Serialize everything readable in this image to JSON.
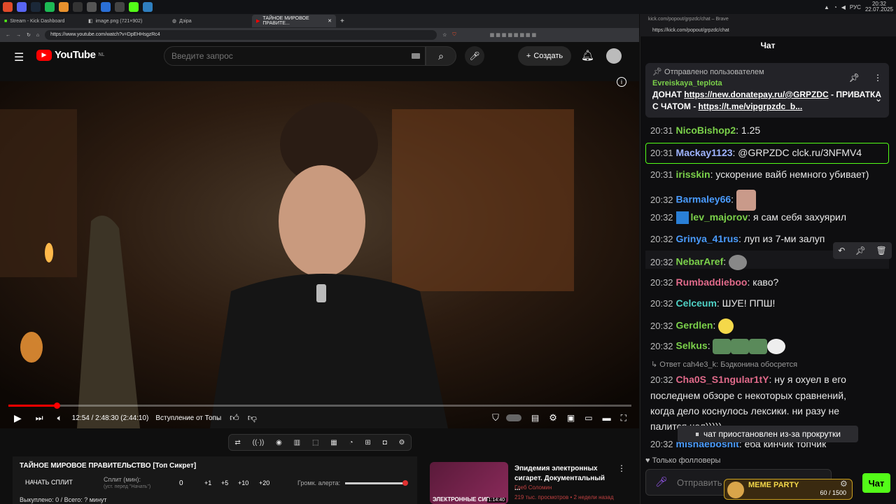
{
  "taskbar": {
    "clock_time": "20:32",
    "clock_date": "22.07.2025",
    "lang": "РУС"
  },
  "browser": {
    "tabs": [
      {
        "label": "Stream - Kick Dashboard"
      },
      {
        "label": "image.png (721×902)"
      },
      {
        "label": "Дзіра"
      },
      {
        "label": "ТАЙНОЕ МИРОВОЕ ПРАВИТЕ..."
      }
    ],
    "url": "https://www.youtube.com/watch?v=DpEHHsgzRc4"
  },
  "youtube": {
    "logo": "YouTube",
    "region": "NL",
    "search_placeholder": "Введите запрос",
    "create_label": "Создать",
    "player": {
      "time": "12:54 / 2:48:30 (2:44:10)",
      "chapter": "Вступление от Топы",
      "progress": 0.077
    },
    "tool_panel": {
      "title": "ТАЙНОЕ МИРОВОЕ ПРАВИТЕЛЬСТВО [Топ Сикрет]",
      "start_split": "НАЧАТЬ СПЛИТ",
      "split_label": "Сплит (мин):",
      "split_hint": "(уст. перед \"Начать\")",
      "split_value": "0",
      "plus1": "+1",
      "plus5": "+5",
      "plus10": "+10",
      "plus20": "+20",
      "alert_volume": "Громк. алерта:",
      "status": "Выкуплено: 0 / Всего: ? минут"
    },
    "recommendation": {
      "title": "Эпидемия электронных сигарет. Документальный ...",
      "channel": "Глеб Соломин",
      "meta": "219 тыс. просмотров • 2 недели назад",
      "duration": "1:14:40",
      "thumb_text": "ЭЛЕКТРОННЫЕ СИГ"
    }
  },
  "chat": {
    "window_title": "kick.com/popout/grpzdc/chat – Brave",
    "url": "https://kick.com/popout/grpzdc/chat",
    "title": "Чат",
    "pinned": {
      "header": "Отправлено пользователем",
      "user": "Evreiskaya_teplota",
      "text1": "ДОНАТ ",
      "link1": "https://new.donatepay.ru/@GRPZDC",
      "text2": " - ПРИВАТКА С ЧАТОМ - ",
      "link2": "https://t.me/vipgrpzdc_b..."
    },
    "messages": [
      {
        "time": "20:31",
        "user": "NicoBishop2",
        "color": "#7bd14a",
        "text": ": 1.25"
      },
      {
        "time": "20:31",
        "user": "Mackay1123",
        "color": "#9fb4ff",
        "text": ": @GRPZDC clck.ru/3NFMV4"
      },
      {
        "time": "20:31",
        "user": "irisskin",
        "color": "#7bd14a",
        "text": ": ускорение вайб немного убивает)"
      },
      {
        "time": "20:32",
        "user": "Barmaley66",
        "color": "#4a9cff",
        "text": ":"
      },
      {
        "time": "20:32",
        "user": "lev_majorov",
        "color": "#7bd14a",
        "text": ": я сам себя захуярил"
      },
      {
        "time": "20:32",
        "user": "Grinya_41rus",
        "color": "#4a9cff",
        "text": ": луп из 7-ми залуп"
      },
      {
        "time": "20:32",
        "user": "NebarAref",
        "color": "#7bd14a",
        "text": ":"
      },
      {
        "time": "20:32",
        "user": "Rumbaddieboo",
        "color": "#e06a8a",
        "text": ": каво?"
      },
      {
        "time": "20:32",
        "user": "Celceum",
        "color": "#4fd1c5",
        "text": ": ШУЕ! ППШ!"
      },
      {
        "time": "20:32",
        "user": "Gerdlen",
        "color": "#7bd14a",
        "text": ":"
      },
      {
        "time": "20:32",
        "user": "Selkus",
        "color": "#7bd14a",
        "text": ":"
      }
    ],
    "reply_note": "Ответ cah4e3_k: Бэдконина обосрется",
    "long_msg": {
      "time": "20:32",
      "user": "Cha0S_S1ngular1tY",
      "color": "#e06a8a",
      "line1": ": ну я охуел в его",
      "line2": "последнем обзоре с некоторых сравнений,",
      "line3": "когда дело коснулось лексики. ни разу не",
      "line4": "палится чел)))))"
    },
    "last_msg": {
      "time": "20:32",
      "user": "mishaebosnit",
      "text": ": еба кинчик топчик"
    },
    "paused": "чат приостановлен из-за прокрутки",
    "followers_only": "Только фолловеры",
    "input_placeholder": "Отправить",
    "send_label": "Чат",
    "meme_party": "MEME PARTY",
    "meme_progress": "60 / 1500"
  }
}
